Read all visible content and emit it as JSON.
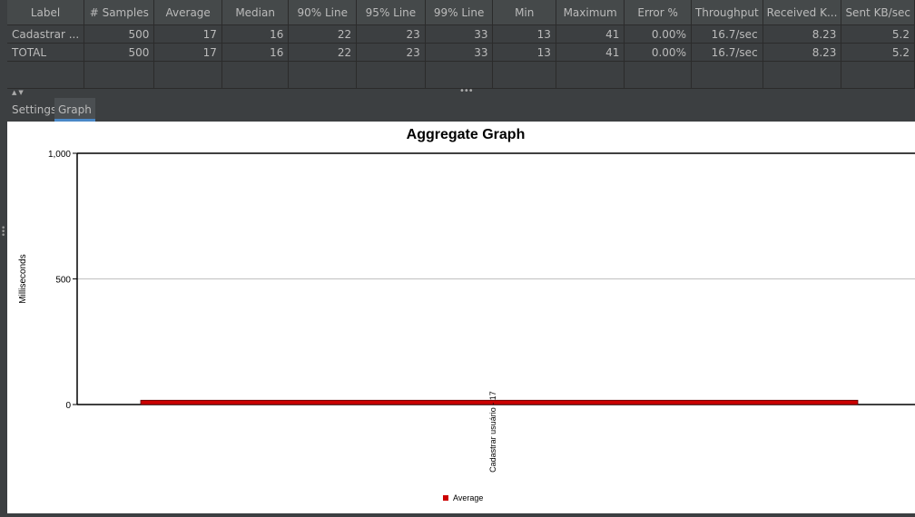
{
  "table": {
    "columns": [
      "Label",
      "# Samples",
      "Average",
      "Median",
      "90% Line",
      "95% Line",
      "99% Line",
      "Min",
      "Maximum",
      "Error %",
      "Throughput",
      "Received K...",
      "Sent KB/sec"
    ],
    "rows": [
      [
        "Cadastrar ...",
        "500",
        "17",
        "16",
        "22",
        "23",
        "33",
        "13",
        "41",
        "0.00%",
        "16.7/sec",
        "8.23",
        "5.2"
      ],
      [
        "TOTAL",
        "500",
        "17",
        "16",
        "22",
        "23",
        "33",
        "13",
        "41",
        "0.00%",
        "16.7/sec",
        "8.23",
        "5.2"
      ]
    ]
  },
  "tabs": {
    "settings": "Settings",
    "graph": "Graph"
  },
  "splitter": {
    "arrows": "▲▼",
    "dots": "•••"
  },
  "chart_data": {
    "type": "bar",
    "title": "Aggregate Graph",
    "ylabel": "Milliseconds",
    "xlabel": "",
    "categories": [
      "Cadastrar usuário"
    ],
    "bar_label": "Cadastrar usuário - 17",
    "series": [
      {
        "name": "Average",
        "values": [
          17
        ],
        "color": "#cc0000"
      }
    ],
    "ylim": [
      0,
      1000
    ],
    "yticks": [
      "0",
      "500",
      "1,000"
    ],
    "grid": true,
    "legend": "bottom"
  }
}
